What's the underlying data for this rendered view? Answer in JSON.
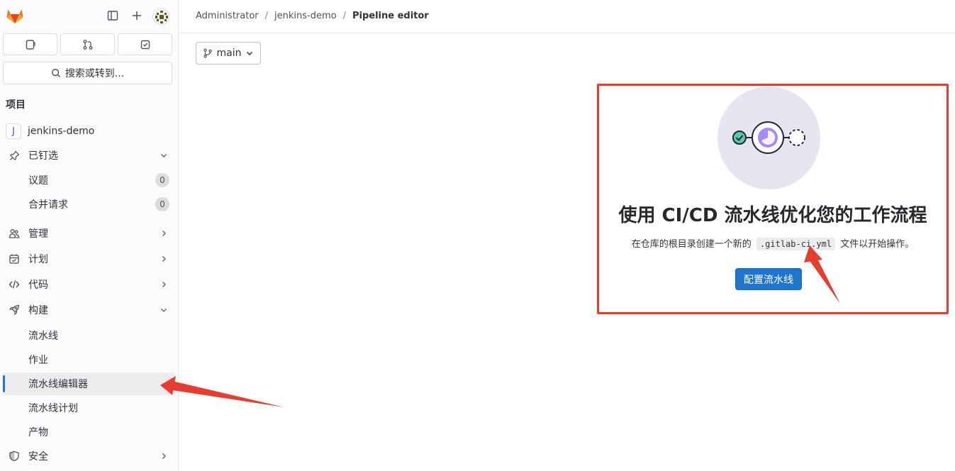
{
  "sidebar": {
    "search_label": "搜索或转到...",
    "section_title": "项目",
    "project_initial": "J",
    "project_name": "jenkins-demo",
    "pinned_label": "已钉选",
    "issues_label": "议题",
    "issues_count": "0",
    "merge_requests_label": "合并请求",
    "merge_requests_count": "0",
    "manage_label": "管理",
    "plan_label": "计划",
    "code_label": "代码",
    "build_label": "构建",
    "pipelines_label": "流水线",
    "jobs_label": "作业",
    "pipeline_editor_label": "流水线编辑器",
    "pipeline_schedules_label": "流水线计划",
    "artifacts_label": "产物",
    "security_label": "安全"
  },
  "breadcrumb": {
    "items": [
      "Administrator",
      "jenkins-demo",
      "Pipeline editor"
    ]
  },
  "branch_selector": {
    "value": "main"
  },
  "empty_state": {
    "title": "使用 CI/CD 流水线优化您的工作流程",
    "desc_before": "在仓库的根目录创建一个新的",
    "file_name": ".gitlab-ci.yml",
    "desc_after": "文件以开始操作。",
    "button_label": "配置流水线"
  },
  "colors": {
    "accent": "#1f75cb",
    "annotation": "#e63d2f",
    "illustration_bg": "#e7e4f2"
  }
}
